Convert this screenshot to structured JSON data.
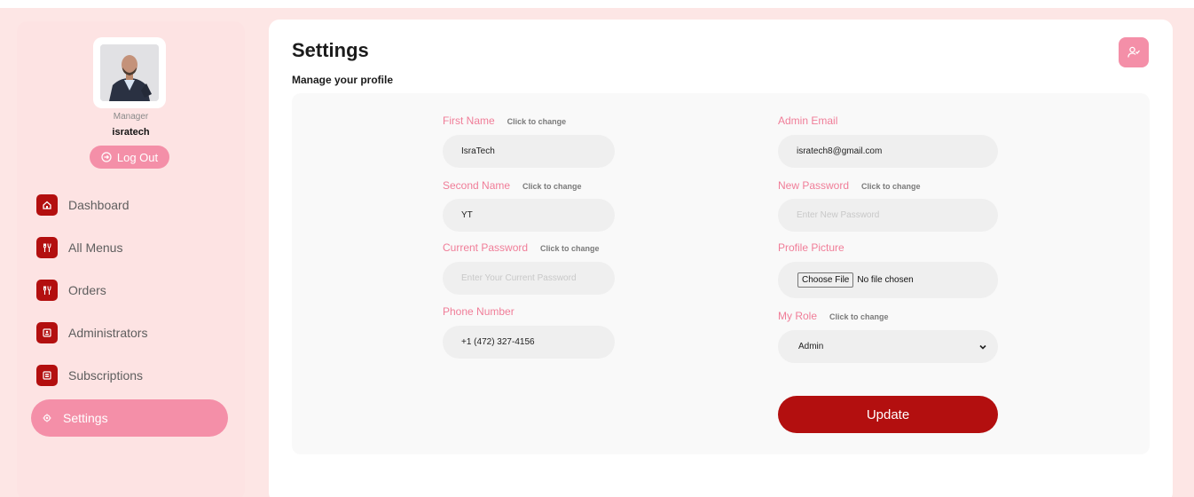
{
  "profile": {
    "role": "Manager",
    "username": "isratech",
    "logout_label": "Log Out"
  },
  "sidebar": {
    "items": [
      {
        "label": "Dashboard",
        "icon": "home-icon"
      },
      {
        "label": "All Menus",
        "icon": "utensils-icon"
      },
      {
        "label": "Orders",
        "icon": "utensils-icon"
      },
      {
        "label": "Administrators",
        "icon": "id-badge-icon"
      },
      {
        "label": "Subscriptions",
        "icon": "newspaper-icon"
      },
      {
        "label": "Settings",
        "icon": "gear-icon",
        "active": true
      }
    ]
  },
  "header": {
    "title": "Settings",
    "subtitle": "Manage your profile"
  },
  "form": {
    "first_name": {
      "label": "First Name",
      "hint": "Click to change",
      "value": "IsraTech"
    },
    "second_name": {
      "label": "Second Name",
      "hint": "Click to change",
      "value": "YT"
    },
    "current_password": {
      "label": "Current Password",
      "hint": "Click to change",
      "placeholder": "Enter Your Current Password"
    },
    "phone": {
      "label": "Phone Number",
      "value": "+1 (472) 327-4156"
    },
    "admin_email": {
      "label": "Admin Email",
      "value": "isratech8@gmail.com"
    },
    "new_password": {
      "label": "New Password",
      "hint": "Click to change",
      "placeholder": "Enter New Password"
    },
    "profile_picture": {
      "label": "Profile Picture",
      "button_label": "Choose File",
      "status": "No file chosen"
    },
    "role": {
      "label": "My Role",
      "hint": "Click to change",
      "selected": "Admin"
    },
    "submit_label": "Update"
  },
  "colors": {
    "accent_pink": "#f48fa8",
    "label_pink": "#f07d98",
    "brand_red": "#b30f0f",
    "background": "#fde6e5"
  }
}
